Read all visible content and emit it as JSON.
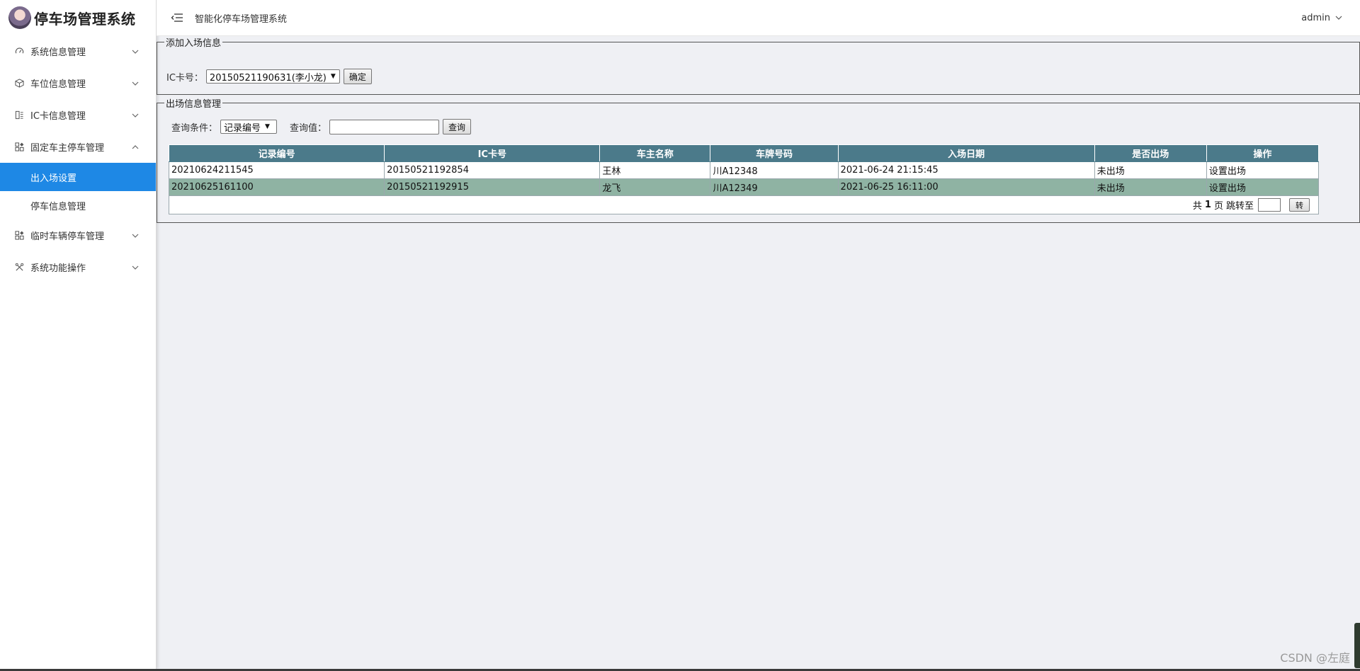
{
  "app": {
    "logo_text": "停车场管理系统",
    "header_title": "智能化停车场管理系统",
    "user": "admin"
  },
  "sidebar": {
    "items": [
      {
        "label": "系统信息管理",
        "icon": "dashboard-icon",
        "expanded": false
      },
      {
        "label": "车位信息管理",
        "icon": "cube-icon",
        "expanded": false
      },
      {
        "label": "IC卡信息管理",
        "icon": "card-icon",
        "expanded": false
      },
      {
        "label": "固定车主停车管理",
        "icon": "grid-icon",
        "expanded": true,
        "children": [
          {
            "label": "出入场设置",
            "active": true
          },
          {
            "label": "停车信息管理",
            "active": false
          }
        ]
      },
      {
        "label": "临时车辆停车管理",
        "icon": "grid-icon",
        "expanded": false
      },
      {
        "label": "系统功能操作",
        "icon": "tools-icon",
        "expanded": false
      }
    ]
  },
  "add_panel": {
    "legend": "添加入场信息",
    "ic_label": "IC卡号：",
    "ic_selected": "20150521190631(李小龙)",
    "confirm_label": "确定"
  },
  "exit_panel": {
    "legend": "出场信息管理",
    "condition_label": "查询条件：",
    "condition_selected": "记录编号",
    "value_label": "查询值：",
    "value_input": "",
    "query_label": "查询"
  },
  "table": {
    "columns": [
      "记录编号",
      "IC卡号",
      "车主名称",
      "车牌号码",
      "入场日期",
      "是否出场",
      "操作"
    ],
    "rows": [
      [
        "20210624211545",
        "20150521192854",
        "王林",
        "川A12348",
        "2021-06-24 21:15:45",
        "未出场",
        "设置出场"
      ],
      [
        "20210625161100",
        "20150521192915",
        "龙飞",
        "川A12349",
        "2021-06-25 16:11:00",
        "未出场",
        "设置出场"
      ]
    ]
  },
  "pager": {
    "total_prefix": "共",
    "total_pages": "1",
    "total_suffix": "页",
    "jump_label": "跳转至",
    "go_label": "转"
  },
  "watermark": "CSDN @左庭",
  "colors": {
    "active_menu": "#1e88e5",
    "table_header": "#4b7a8a",
    "row_alt": "#8fb3a3",
    "page_bg": "#eff0f4"
  }
}
